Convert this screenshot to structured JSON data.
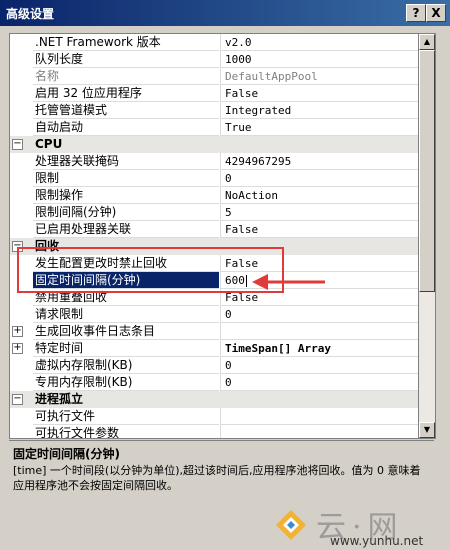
{
  "window": {
    "title": "高级设置",
    "help_label": "?",
    "close_label": "X"
  },
  "properties": [
    {
      "kind": "prop",
      "name": ".NET Framework 版本",
      "value": "v2.0"
    },
    {
      "kind": "prop",
      "name": "队列长度",
      "value": "1000"
    },
    {
      "kind": "prop",
      "name": "名称",
      "value": "DefaultAppPool",
      "dim": true
    },
    {
      "kind": "prop",
      "name": "启用 32 位应用程序",
      "value": "False"
    },
    {
      "kind": "prop",
      "name": "托管管道模式",
      "value": "Integrated"
    },
    {
      "kind": "prop",
      "name": "自动启动",
      "value": "True"
    },
    {
      "kind": "cat",
      "name": "CPU",
      "glyph": "−"
    },
    {
      "kind": "prop",
      "name": "处理器关联掩码",
      "value": "4294967295"
    },
    {
      "kind": "prop",
      "name": "限制",
      "value": "0"
    },
    {
      "kind": "prop",
      "name": "限制操作",
      "value": "NoAction"
    },
    {
      "kind": "prop",
      "name": "限制间隔(分钟)",
      "value": "5"
    },
    {
      "kind": "prop",
      "name": "已启用处理器关联",
      "value": "False"
    },
    {
      "kind": "cat",
      "name": "回收",
      "glyph": "−"
    },
    {
      "kind": "prop",
      "name": "发生配置更改时禁止回收",
      "value": "False"
    },
    {
      "kind": "prop",
      "name": "固定时间间隔(分钟)",
      "value": "600",
      "selected": true
    },
    {
      "kind": "prop",
      "name": "禁用重叠回收",
      "value": "False"
    },
    {
      "kind": "prop",
      "name": "请求限制",
      "value": "0"
    },
    {
      "kind": "prop",
      "name": "生成回收事件日志条目",
      "value": "",
      "glyph": "+"
    },
    {
      "kind": "prop",
      "name": "特定时间",
      "value": "TimeSpan[] Array",
      "glyph": "+",
      "bold": true
    },
    {
      "kind": "prop",
      "name": "虚拟内存限制(KB)",
      "value": "0"
    },
    {
      "kind": "prop",
      "name": "专用内存限制(KB)",
      "value": "0"
    },
    {
      "kind": "cat",
      "name": "进程孤立",
      "glyph": "−"
    },
    {
      "kind": "prop",
      "name": "可执行文件",
      "value": ""
    },
    {
      "kind": "prop",
      "name": "可执行文件参数",
      "value": ""
    }
  ],
  "description": {
    "title": "固定时间间隔(分钟)",
    "text": "[time] 一个时间段(以分钟为单位),超过该时间后,应用程序池将回收。值为 0 意味着应用程序池不会按固定间隔回收。"
  },
  "watermark": {
    "text": "云·网",
    "url": "www.yunhu.net"
  },
  "colors": {
    "highlight": "#e03a3a",
    "selection": "#0a246a",
    "titlebar": "#0a246a"
  }
}
